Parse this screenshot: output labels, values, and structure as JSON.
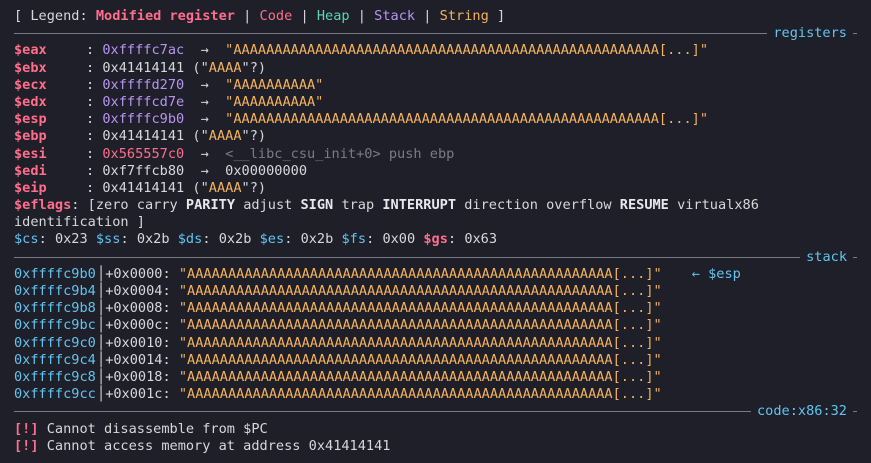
{
  "legend": {
    "prefix": "[ Legend: ",
    "modified": "Modified register",
    "code": "Code",
    "heap": "Heap",
    "stack": "Stack",
    "string": "String",
    "suffix": " ]"
  },
  "sections": {
    "registers": "registers",
    "stack": "stack",
    "code": "code:x86:32"
  },
  "registers": [
    {
      "name": "$eax",
      "value": "0xffffc7ac",
      "arrow": "→",
      "deref": "\"AAAAAAAAAAAAAAAAAAAAAAAAAAAAAAAAAAAAAAAAAAAAAAAAAAAA[...]\"",
      "modified": true,
      "kind": "string"
    },
    {
      "name": "$ebx",
      "value": "0x41414141",
      "open": "(\"",
      "deref": "AAAA",
      "close": "\"?)",
      "modified": false,
      "kind": "ascii"
    },
    {
      "name": "$ecx",
      "value": "0xffffd270",
      "arrow": "→",
      "deref": "\"AAAAAAAAAA\"",
      "modified": true,
      "kind": "string"
    },
    {
      "name": "$edx",
      "value": "0xffffcd7e",
      "arrow": "→",
      "deref": "\"AAAAAAAAAA\"",
      "modified": true,
      "kind": "string"
    },
    {
      "name": "$esp",
      "value": "0xffffc9b0",
      "arrow": "→",
      "deref": "\"AAAAAAAAAAAAAAAAAAAAAAAAAAAAAAAAAAAAAAAAAAAAAAAAAAAA[...]\"",
      "modified": true,
      "kind": "string"
    },
    {
      "name": "$ebp",
      "value": "0x41414141",
      "open": "(\"",
      "deref": "AAAA",
      "close": "\"?)",
      "modified": false,
      "kind": "ascii"
    },
    {
      "name": "$esi",
      "value": "0x565557c0",
      "arrow": "→",
      "deref": "<__libc_csu_init+0> push ebp",
      "modified": true,
      "kind": "code"
    },
    {
      "name": "$edi",
      "value": "0xf7ffcb80",
      "arrow": "→",
      "deref": "0x00000000",
      "modified": false,
      "kind": "plain"
    },
    {
      "name": "$eip",
      "value": "0x41414141",
      "open": "(\"",
      "deref": "AAAA",
      "close": "\"?)",
      "modified": false,
      "kind": "ascii"
    }
  ],
  "eflags": {
    "label": "$eflags",
    "open": "[",
    "flags": [
      {
        "t": "zero",
        "set": false
      },
      {
        "t": "carry",
        "set": false
      },
      {
        "t": "PARITY",
        "set": true
      },
      {
        "t": "adjust",
        "set": false
      },
      {
        "t": "SIGN",
        "set": true
      },
      {
        "t": "trap",
        "set": false
      },
      {
        "t": "INTERRUPT",
        "set": true
      },
      {
        "t": "direction",
        "set": false
      },
      {
        "t": "overflow",
        "set": false
      },
      {
        "t": "RESUME",
        "set": true
      },
      {
        "t": "virtualx86",
        "set": false
      },
      {
        "t": "identification",
        "set": false
      }
    ],
    "close": "]"
  },
  "segments": [
    {
      "name": "$cs",
      "value": "0x23"
    },
    {
      "name": "$ss",
      "value": "0x2b"
    },
    {
      "name": "$ds",
      "value": "0x2b"
    },
    {
      "name": "$es",
      "value": "0x2b"
    },
    {
      "name": "$fs",
      "value": "0x00"
    },
    {
      "name": "$gs",
      "value": "0x63"
    }
  ],
  "stack_rows": [
    {
      "addr": "0xffffc9b0",
      "offset": "+0x0000:",
      "value": "\"AAAAAAAAAAAAAAAAAAAAAAAAAAAAAAAAAAAAAAAAAAAAAAAAAAAA[...]\"",
      "tag": "← $esp"
    },
    {
      "addr": "0xffffc9b4",
      "offset": "+0x0004:",
      "value": "\"AAAAAAAAAAAAAAAAAAAAAAAAAAAAAAAAAAAAAAAAAAAAAAAAAAAA[...]\"",
      "tag": ""
    },
    {
      "addr": "0xffffc9b8",
      "offset": "+0x0008:",
      "value": "\"AAAAAAAAAAAAAAAAAAAAAAAAAAAAAAAAAAAAAAAAAAAAAAAAAAAA[...]\"",
      "tag": ""
    },
    {
      "addr": "0xffffc9bc",
      "offset": "+0x000c:",
      "value": "\"AAAAAAAAAAAAAAAAAAAAAAAAAAAAAAAAAAAAAAAAAAAAAAAAAAAA[...]\"",
      "tag": ""
    },
    {
      "addr": "0xffffc9c0",
      "offset": "+0x0010:",
      "value": "\"AAAAAAAAAAAAAAAAAAAAAAAAAAAAAAAAAAAAAAAAAAAAAAAAAAAA[...]\"",
      "tag": ""
    },
    {
      "addr": "0xffffc9c4",
      "offset": "+0x0014:",
      "value": "\"AAAAAAAAAAAAAAAAAAAAAAAAAAAAAAAAAAAAAAAAAAAAAAAAAAAA[...]\"",
      "tag": ""
    },
    {
      "addr": "0xffffc9c8",
      "offset": "+0x0018:",
      "value": "\"AAAAAAAAAAAAAAAAAAAAAAAAAAAAAAAAAAAAAAAAAAAAAAAAAAAA[...]\"",
      "tag": ""
    },
    {
      "addr": "0xffffc9cc",
      "offset": "+0x001c:",
      "value": "\"AAAAAAAAAAAAAAAAAAAAAAAAAAAAAAAAAAAAAAAAAAAAAAAAAAAA[...]\"",
      "tag": ""
    }
  ],
  "messages": [
    {
      "marker": "[!]",
      "text": " Cannot disassemble from $PC"
    },
    {
      "marker": "[!]",
      "text": " Cannot access memory at address 0x41414141"
    }
  ],
  "colors": {
    "background": "#1e1f29",
    "modified": "#ff6e8b",
    "code": "#ff6e8b",
    "heap": "#59d7b4",
    "stack": "#b894f0",
    "string": "#f4b25d",
    "section_title": "#62c4f0"
  }
}
